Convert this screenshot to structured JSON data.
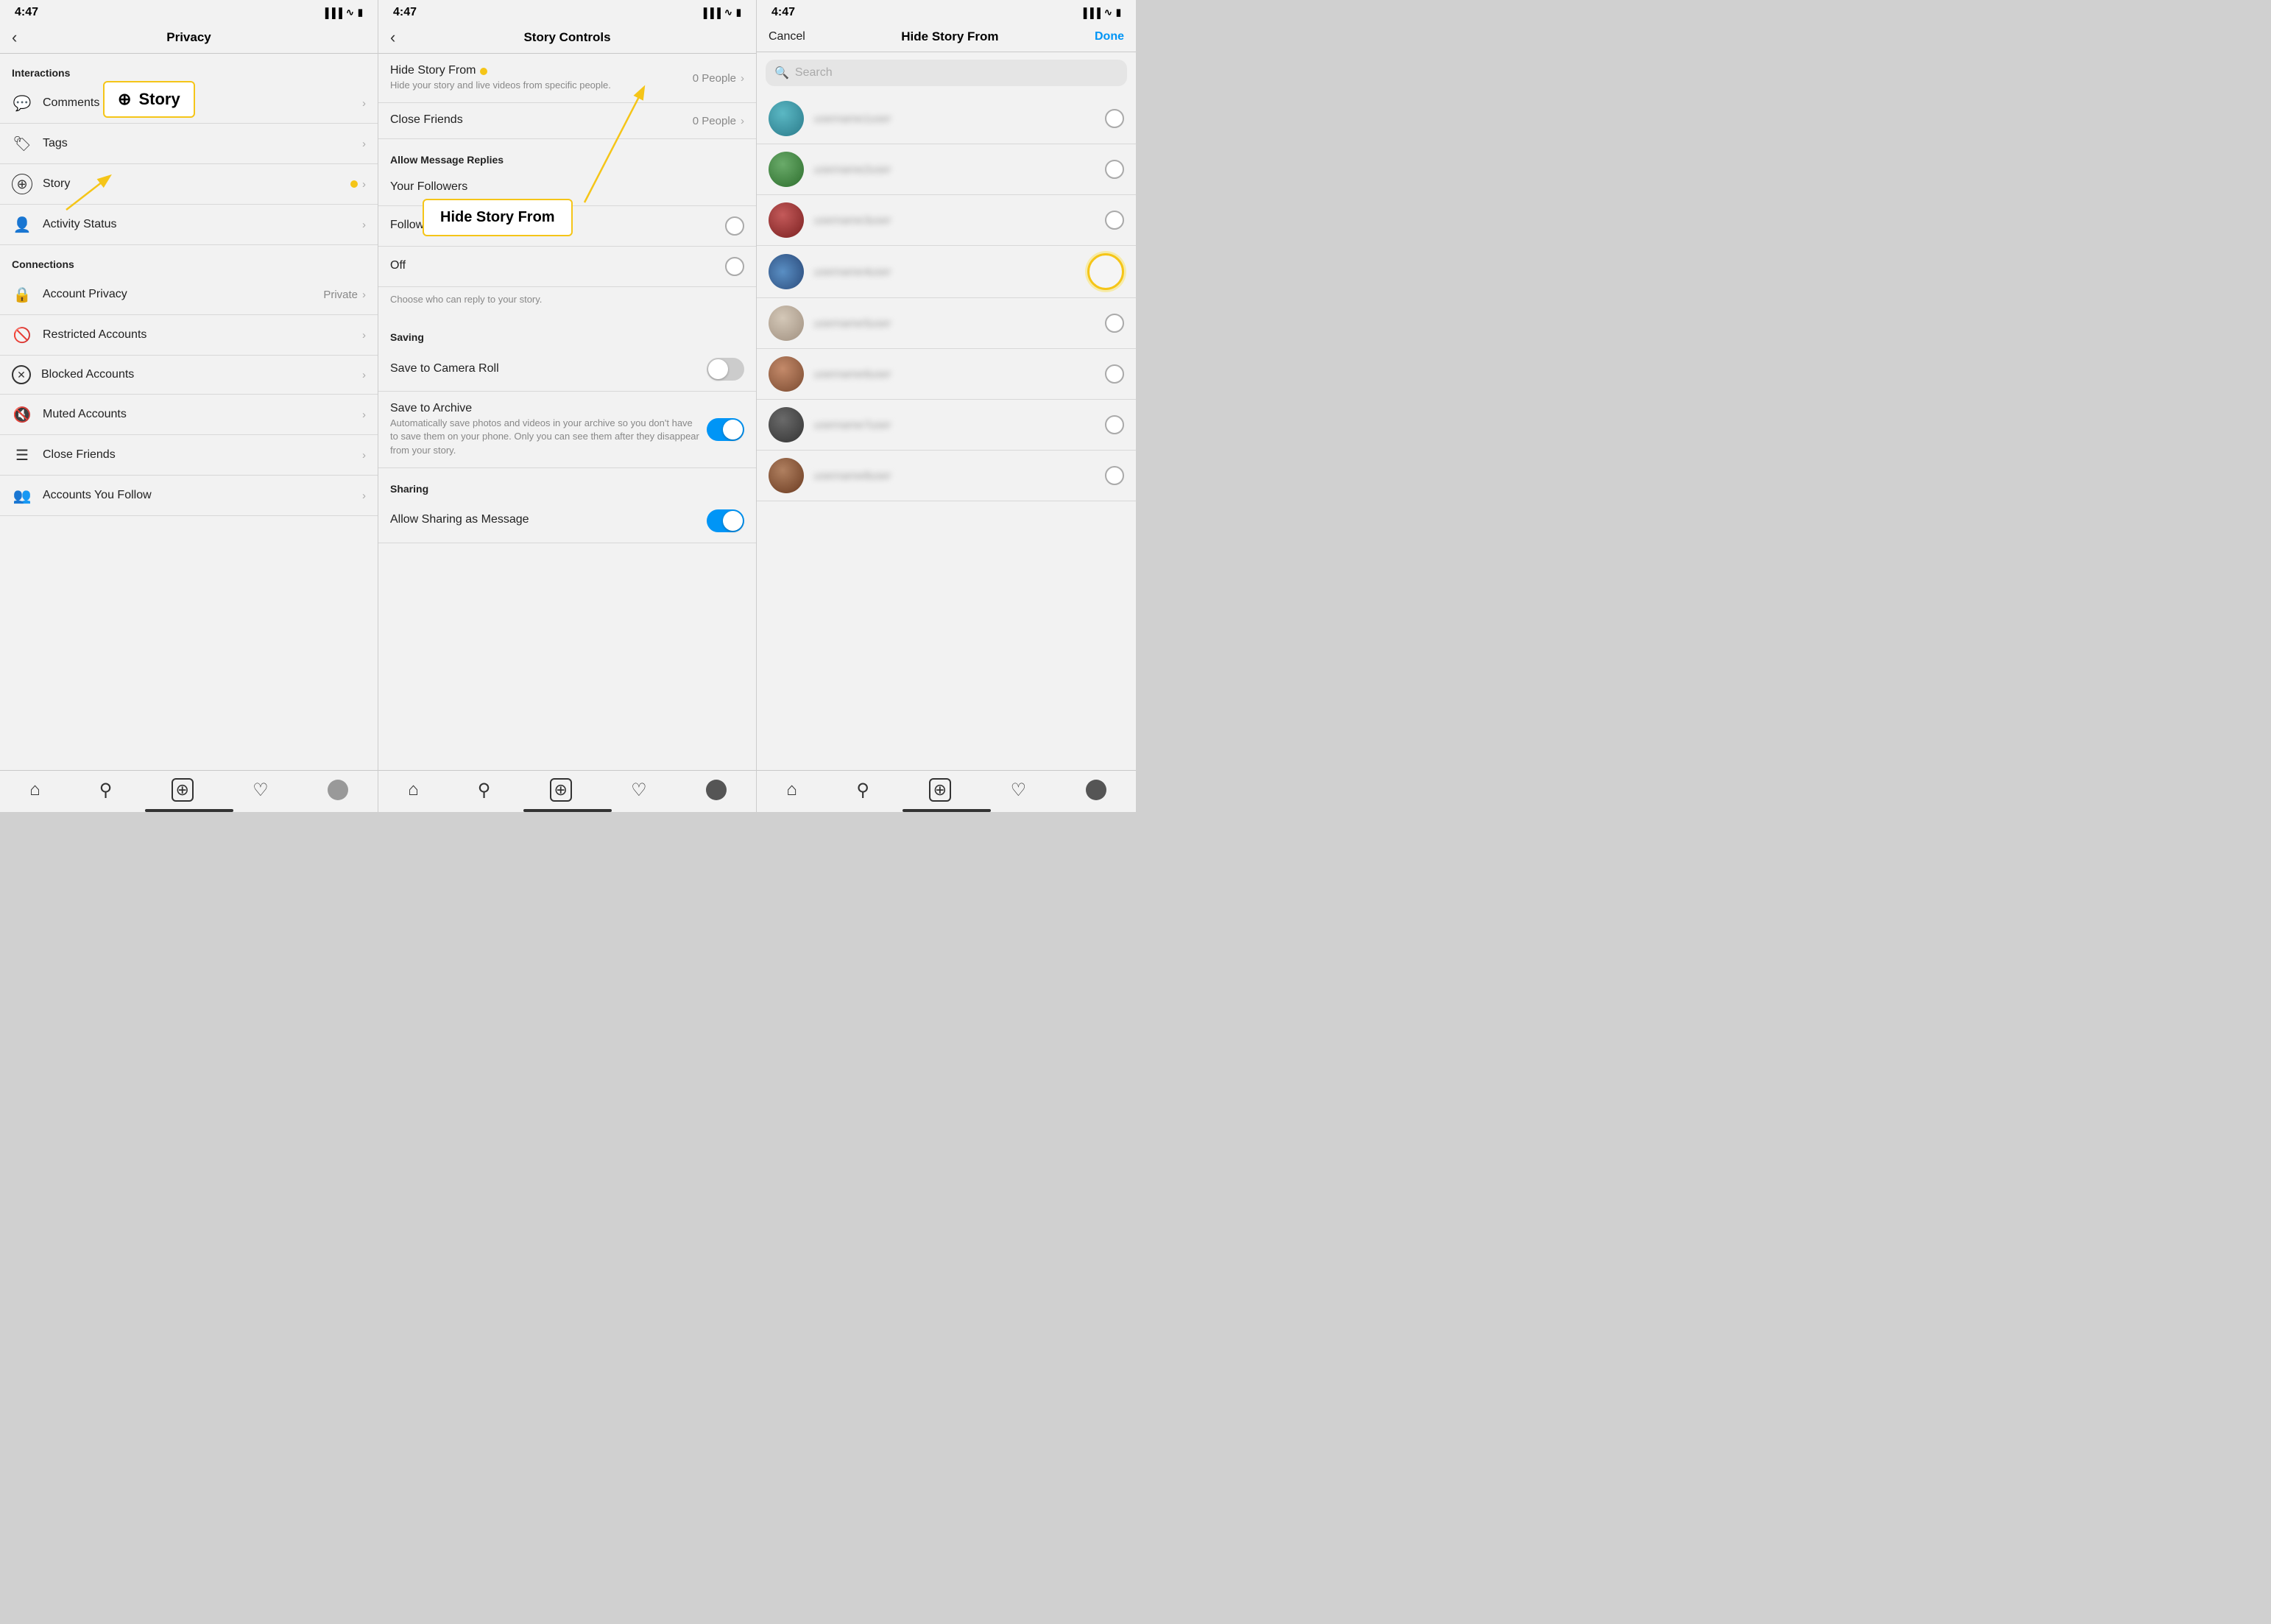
{
  "panel1": {
    "status_time": "4:47",
    "title": "Privacy",
    "section_interactions": "Interactions",
    "section_connections": "Connections",
    "items_interactions": [
      {
        "label": "Comments",
        "icon": "💬",
        "value": ""
      },
      {
        "label": "Tags",
        "icon": "🏷",
        "value": ""
      },
      {
        "label": "Story",
        "icon": "⊕",
        "value": ""
      },
      {
        "label": "Activity Status",
        "icon": "👤",
        "value": ""
      }
    ],
    "items_connections": [
      {
        "label": "Account Privacy",
        "icon": "🔒",
        "value": "Private"
      },
      {
        "label": "Restricted Accounts",
        "icon": "🚫",
        "value": ""
      },
      {
        "label": "Blocked Accounts",
        "icon": "✕",
        "value": ""
      },
      {
        "label": "Muted Accounts",
        "icon": "🔇",
        "value": ""
      },
      {
        "label": "Close Friends",
        "icon": "☰",
        "value": ""
      },
      {
        "label": "Accounts You Follow",
        "icon": "👥",
        "value": ""
      }
    ],
    "story_callout": "Story",
    "bottom_nav": [
      "🏠",
      "🔍",
      "⊕",
      "♡",
      "👤"
    ]
  },
  "panel2": {
    "status_time": "4:47",
    "title": "Story Controls",
    "hide_story_from_label": "Hide Story From",
    "hide_story_from_value": "0 People",
    "hide_story_from_subtitle": "Hide your story and live videos from specific people.",
    "close_friends_label": "Close Friends",
    "close_friends_value": "0 People",
    "allow_message_replies": "Allow Message Replies",
    "your_followers": "Your Followers",
    "followers_follow_back": "Followers You Follow Back",
    "off": "Off",
    "choose_reply_hint": "Choose who can reply to your story.",
    "saving": "Saving",
    "save_camera_roll": "Save to Camera Roll",
    "save_archive": "Save to Archive",
    "save_archive_subtitle": "Automatically save photos and videos in your archive so you don't have to save them on your phone. Only you can see them after they disappear from your story.",
    "sharing": "Sharing",
    "allow_sharing": "Allow Sharing as Message",
    "hide_callout": "Hide Story From",
    "bottom_nav": [
      "🏠",
      "🔍",
      "⊕",
      "♡",
      "👤"
    ]
  },
  "panel3": {
    "status_time": "4:47",
    "title": "Hide Story From",
    "cancel": "Cancel",
    "done": "Done",
    "search_placeholder": "Search",
    "users": [
      {
        "color": "avatar-teal",
        "name": "username1"
      },
      {
        "color": "avatar-green",
        "name": "username2"
      },
      {
        "color": "avatar-red",
        "name": "username3"
      },
      {
        "color": "avatar-landscape",
        "name": "username4"
      },
      {
        "color": "avatar-light",
        "name": "username5"
      },
      {
        "color": "avatar-portrait",
        "name": "username6"
      },
      {
        "color": "avatar-dark",
        "name": "username7"
      },
      {
        "color": "avatar-brown",
        "name": "username8"
      }
    ],
    "bottom_nav": [
      "🏠",
      "🔍",
      "⊕",
      "♡",
      "👤"
    ]
  }
}
